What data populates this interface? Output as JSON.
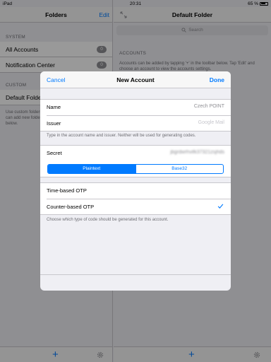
{
  "status_bar": {
    "device": "iPad",
    "time": "20:31",
    "battery": "65 %"
  },
  "master": {
    "title": "Folders",
    "edit_label": "Edit",
    "system_header": "SYSTEM",
    "system_items": [
      {
        "label": "All Accounts",
        "count": "0"
      },
      {
        "label": "Notification Center",
        "count": "0"
      }
    ],
    "custom_header": "CUSTOM",
    "custom_item": "Default Folder",
    "custom_note": "Use custom folders to organize your accounts. You can add new folders with the '+' button in the toolbar below."
  },
  "detail": {
    "title": "Default Folder",
    "search_placeholder": "Search",
    "accounts_header": "ACCOUNTS",
    "accounts_note": "Accounts can be added by tapping '+' in the toolbar below. Tap 'Edit' and choose an account to view the accounts settings."
  },
  "toolbar": {
    "add_icon": "plus-icon",
    "settings_icon": "gear-icon"
  },
  "sheet": {
    "cancel": "Cancel",
    "title": "New Account",
    "done": "Done",
    "name_label": "Name",
    "name_value": "Czech POINT",
    "issuer_label": "Issuer",
    "issuer_placeholder": "Google Mail",
    "name_issuer_note": "Type in the account name and issuer. Neither will be used for generating codes.",
    "secret_label": "Secret",
    "secret_value": "jbgrdwrhvifk37321zsjhds",
    "encoding_options": [
      "Plaintext",
      "Base32"
    ],
    "encoding_selected": "Plaintext",
    "otp_options": [
      {
        "label": "Time-based OTP",
        "checked": false
      },
      {
        "label": "Counter-based OTP",
        "checked": true
      }
    ],
    "otp_note": "Choose which type of code should be generated for this account."
  },
  "colors": {
    "accent": "#007aff",
    "background": "#efeff4",
    "separator": "#c8c7cc",
    "badge": "#8e8e93"
  }
}
